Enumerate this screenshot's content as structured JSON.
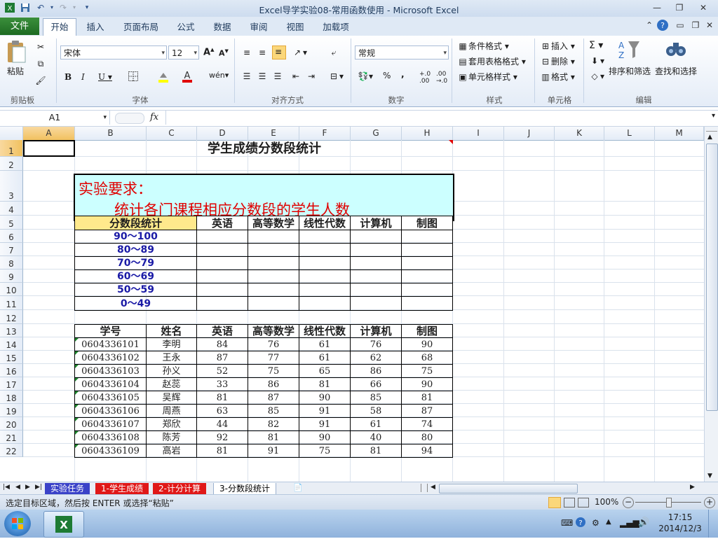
{
  "window": {
    "title": "Excel导学实验08-常用函数使用  -  Microsoft Excel"
  },
  "ribbon": {
    "file_tab": "文件",
    "tabs": [
      "开始",
      "插入",
      "页面布局",
      "公式",
      "数据",
      "审阅",
      "视图",
      "加载项"
    ],
    "clipboard": {
      "paste": "粘贴",
      "group": "剪贴板"
    },
    "font": {
      "name": "宋体",
      "size": "12",
      "group": "字体"
    },
    "alignment": {
      "group": "对齐方式"
    },
    "number": {
      "format": "常规",
      "group": "数字"
    },
    "styles": {
      "conditional": "条件格式",
      "table": "套用表格格式",
      "cell_styles": "单元格样式",
      "group": "样式"
    },
    "cells": {
      "insert": "插入",
      "delete": "删除",
      "format": "格式",
      "group": "单元格"
    },
    "editing": {
      "sort": "排序和筛选",
      "find": "查找和选择",
      "group": "编辑"
    }
  },
  "formula_bar": {
    "name_box": "A1",
    "fx": "fx",
    "value": ""
  },
  "columns": [
    "A",
    "B",
    "C",
    "D",
    "E",
    "F",
    "G",
    "H",
    "I",
    "J",
    "K",
    "L",
    "M"
  ],
  "rows": [
    "1",
    "2",
    "3",
    "4",
    "5",
    "6",
    "7",
    "8",
    "9",
    "10",
    "11",
    "12",
    "13",
    "14",
    "15",
    "16",
    "17",
    "18",
    "19",
    "20",
    "21",
    "22"
  ],
  "sheet": {
    "title": "学生成绩分数段统计",
    "req_title": "实验要求：",
    "req_text": "统计各门课程相应分数段的学生人数",
    "stat_headers": [
      "分数段统计",
      "英语",
      "高等数学",
      "线性代数",
      "计算机",
      "制图"
    ],
    "ranges": [
      "90～100",
      "80～89",
      "70～79",
      "60～69",
      "50～59",
      "0～49"
    ],
    "score_headers": [
      "学号",
      "姓名",
      "英语",
      "高等数学",
      "线性代数",
      "计算机",
      "制图"
    ],
    "students": [
      [
        "0604336101",
        "李明",
        "84",
        "76",
        "61",
        "76",
        "90"
      ],
      [
        "0604336102",
        "王永",
        "87",
        "77",
        "61",
        "62",
        "68"
      ],
      [
        "0604336103",
        "孙义",
        "52",
        "75",
        "65",
        "86",
        "75"
      ],
      [
        "0604336104",
        "赵蕊",
        "33",
        "86",
        "81",
        "66",
        "90"
      ],
      [
        "0604336105",
        "吴辉",
        "81",
        "87",
        "90",
        "85",
        "81"
      ],
      [
        "0604336106",
        "周燕",
        "63",
        "85",
        "91",
        "58",
        "87"
      ],
      [
        "0604336107",
        "郑欣",
        "44",
        "82",
        "91",
        "61",
        "74"
      ],
      [
        "0604336108",
        "陈芳",
        "92",
        "81",
        "90",
        "40",
        "80"
      ],
      [
        "0604336109",
        "高岩",
        "81",
        "91",
        "75",
        "81",
        "94"
      ]
    ]
  },
  "sheet_tabs": [
    "实验任务",
    "1-学生成绩",
    "2-计分计算",
    "3-分数段统计"
  ],
  "status": {
    "message": "选定目标区域，然后按 ENTER 或选择“粘贴”",
    "zoom": "100%"
  },
  "taskbar": {
    "time": "17:15",
    "date": "2014/12/3"
  }
}
